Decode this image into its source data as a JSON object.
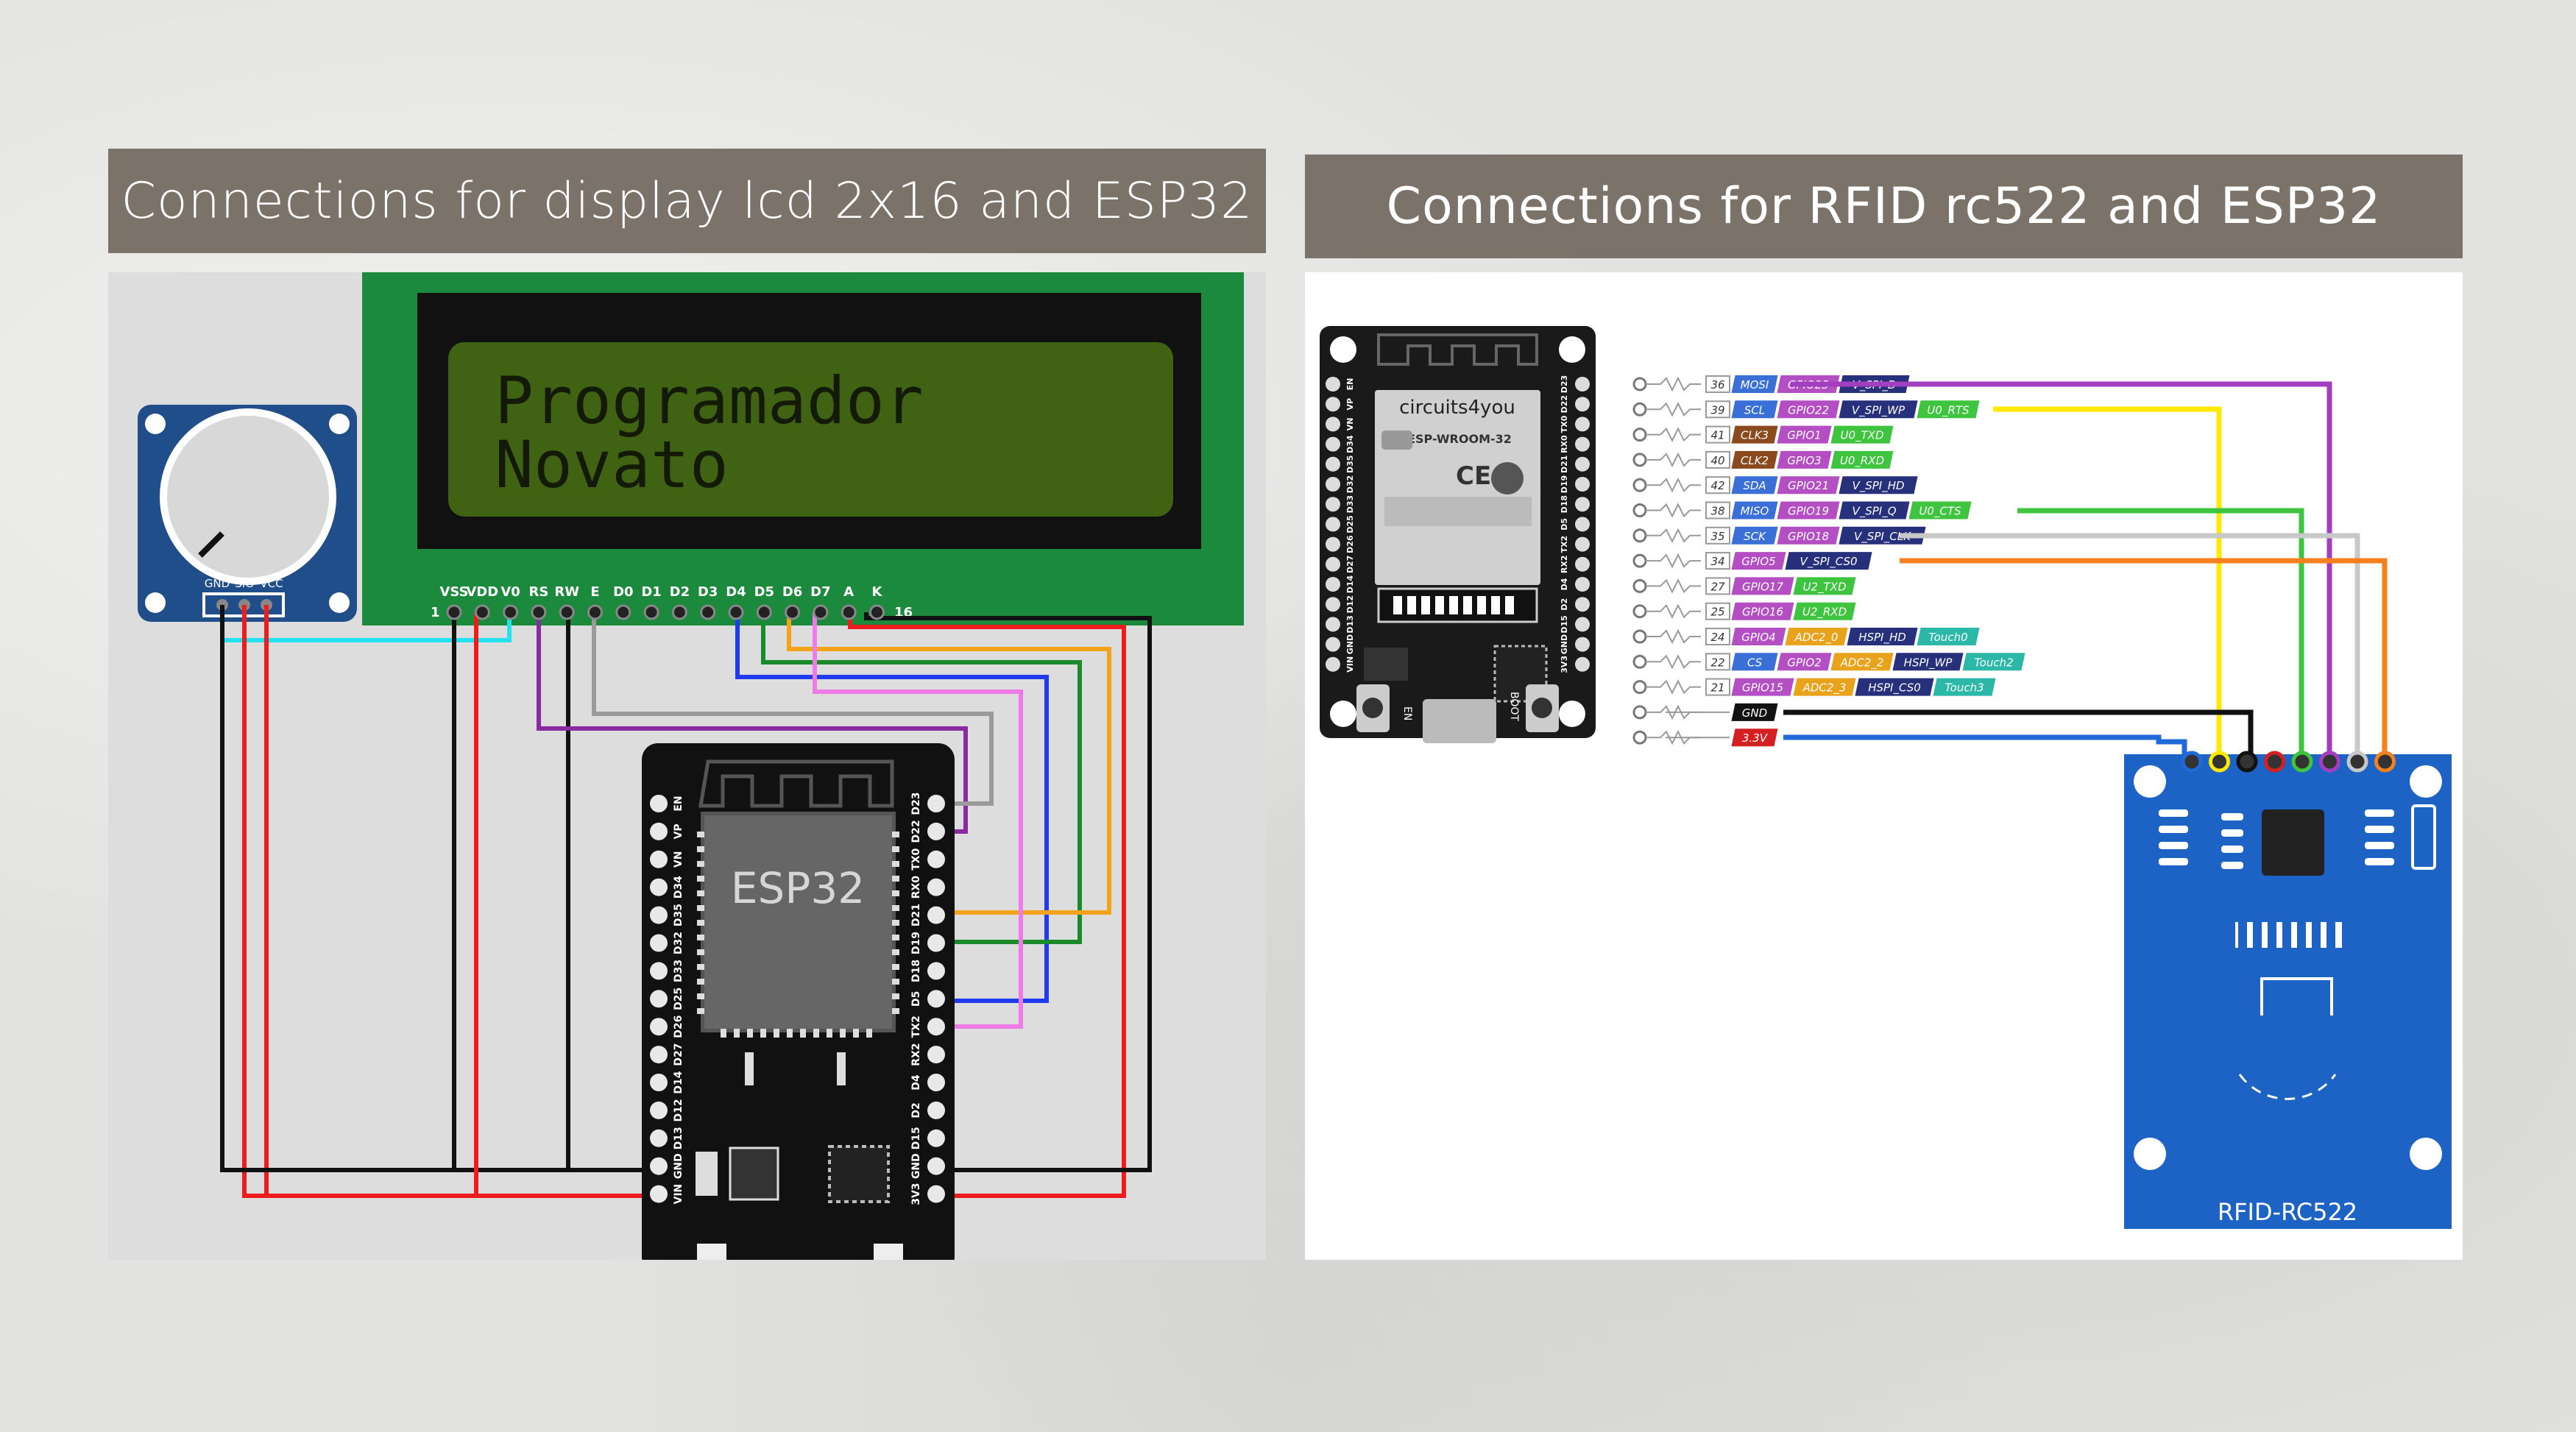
{
  "left": {
    "title": "Connections for display lcd 2x16 and ESP32",
    "lcd": {
      "line1": "Programador",
      "line2": "Novato",
      "pins": [
        "VSS",
        "VDD",
        "V0",
        "RS",
        "RW",
        "E",
        "D0",
        "D1",
        "D2",
        "D3",
        "D4",
        "D5",
        "D6",
        "D7",
        "A",
        "K"
      ],
      "pin_first": "1",
      "pin_last": "16"
    },
    "pot_pins": [
      "GND",
      "SIG",
      "VCC"
    ],
    "esp32": {
      "label": "ESP32",
      "left_pins": [
        "EN",
        "VP",
        "VN",
        "D34",
        "D35",
        "D32",
        "D33",
        "D25",
        "D26",
        "D27",
        "D14",
        "D12",
        "D13",
        "GND",
        "VIN"
      ],
      "right_pins": [
        "D23",
        "D22",
        "TX0",
        "RX0",
        "D21",
        "D19",
        "D18",
        "D5",
        "TX2",
        "RX2",
        "D4",
        "D2",
        "D15",
        "GND",
        "3V3"
      ]
    }
  },
  "right": {
    "title": "Connections for RFID rc522 and ESP32",
    "board": {
      "brand": "circuits4you",
      "module": "ESP-WROOM-32",
      "left_pins": [
        "EN",
        "VP",
        "VN",
        "D34",
        "D35",
        "D32",
        "D33",
        "D25",
        "D26",
        "D27",
        "D14",
        "D12",
        "D13",
        "GND",
        "VIN"
      ],
      "right_pins": [
        "D23",
        "D22",
        "TX0",
        "RX0",
        "D21",
        "D19",
        "D18",
        "D5",
        "TX2",
        "RX2",
        "D4",
        "D2",
        "D15",
        "GND",
        "3V3"
      ],
      "btn_en": "EN",
      "btn_boot": "BOOT"
    },
    "pinout": [
      {
        "num": "36",
        "labels": [
          "MOSI",
          "GPIO23",
          "V_SPI_D"
        ]
      },
      {
        "num": "39",
        "labels": [
          "SCL",
          "GPIO22",
          "V_SPI_WP",
          "U0_RTS"
        ]
      },
      {
        "num": "41",
        "labels": [
          "CLK3",
          "GPIO1",
          "U0_TXD"
        ]
      },
      {
        "num": "40",
        "labels": [
          "CLK2",
          "GPIO3",
          "U0_RXD"
        ]
      },
      {
        "num": "42",
        "labels": [
          "SDA",
          "GPIO21",
          "V_SPI_HD"
        ]
      },
      {
        "num": "38",
        "labels": [
          "MISO",
          "GPIO19",
          "V_SPI_Q",
          "U0_CTS"
        ]
      },
      {
        "num": "35",
        "labels": [
          "SCK",
          "GPIO18",
          "V_SPI_CLK"
        ]
      },
      {
        "num": "34",
        "labels": [
          "GPIO5",
          "V_SPI_CS0"
        ]
      },
      {
        "num": "27",
        "labels": [
          "GPIO17",
          "U2_TXD"
        ]
      },
      {
        "num": "25",
        "labels": [
          "GPIO16",
          "U2_RXD"
        ]
      },
      {
        "num": "24",
        "labels": [
          "GPIO4",
          "ADC2_0",
          "HSPI_HD",
          "Touch0"
        ]
      },
      {
        "num": "22",
        "labels": [
          "CS",
          "GPIO2",
          "ADC2_2",
          "HSPI_WP",
          "Touch2"
        ]
      },
      {
        "num": "21",
        "labels": [
          "GPIO15",
          "ADC2_3",
          "HSPI_CS0",
          "Touch3"
        ]
      },
      {
        "num": "",
        "labels": [
          "GND"
        ]
      },
      {
        "num": "",
        "labels": [
          "3.3V"
        ]
      }
    ],
    "rfid_label": "RFID-RC522"
  },
  "colors": {
    "header_bg": "#7b726a",
    "lcd_green": "#1b8a3c",
    "lcd_screen": "#3f6312",
    "wire_cyan": "#22e2ef",
    "wire_red": "#ee1c1c",
    "wire_purple": "#8a2aa0",
    "wire_gray": "#9a9a9a",
    "wire_blue": "#1f3bf0",
    "wire_green": "#1a8a2a",
    "wire_orange": "#f5a21b",
    "wire_pink": "#ee7be8",
    "rfid_blue": "#1c63c5"
  }
}
